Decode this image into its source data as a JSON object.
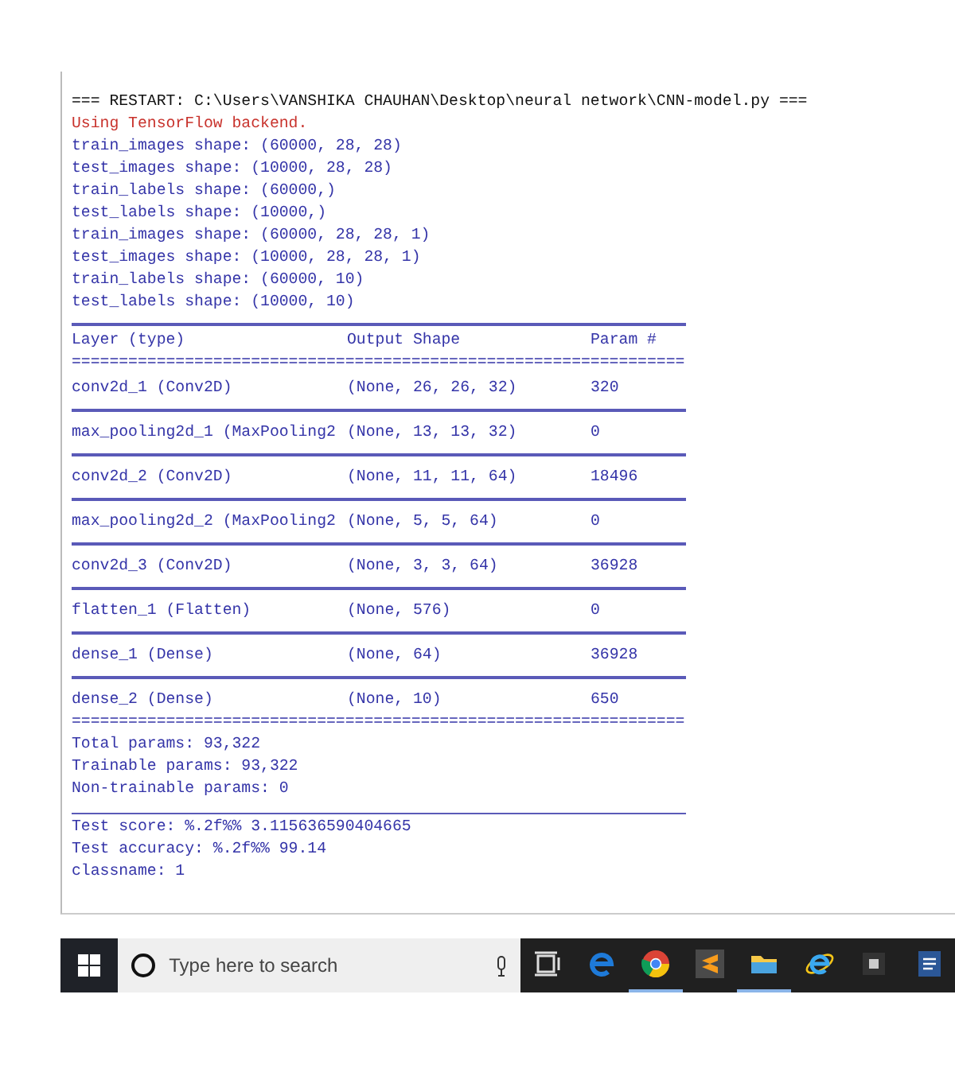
{
  "console": {
    "lines": [
      {
        "kind": "restart",
        "text": "=== RESTART: C:\\Users\\VANSHIKA CHAUHAN\\Desktop\\neural network\\CNN-model.py ==="
      },
      {
        "kind": "stderr",
        "text": "Using TensorFlow backend."
      },
      {
        "kind": "stdout",
        "text": "train_images shape: (60000, 28, 28)"
      },
      {
        "kind": "stdout",
        "text": "test_images shape: (10000, 28, 28)"
      },
      {
        "kind": "stdout",
        "text": "train_labels shape: (60000,)"
      },
      {
        "kind": "stdout",
        "text": "test_labels shape: (10000,)"
      },
      {
        "kind": "stdout",
        "text": "train_images shape: (60000, 28, 28, 1)"
      },
      {
        "kind": "stdout",
        "text": "test_images shape: (10000, 28, 28, 1)"
      },
      {
        "kind": "stdout",
        "text": "train_labels shape: (60000, 10)"
      },
      {
        "kind": "stdout",
        "text": "test_labels shape: (10000, 10)"
      }
    ],
    "summary": {
      "columns": [
        "Layer (type)",
        "Output Shape",
        "Param #"
      ],
      "double_rule": "=================================================================",
      "rows": [
        {
          "cells": [
            "conv2d_1 (Conv2D)",
            "(None, 26, 26, 32)",
            "320"
          ]
        },
        {
          "cells": [
            "max_pooling2d_1 (MaxPooling2",
            "(None, 13, 13, 32)",
            "0"
          ]
        },
        {
          "cells": [
            "conv2d_2 (Conv2D)",
            "(None, 11, 11, 64)",
            "18496"
          ]
        },
        {
          "cells": [
            "max_pooling2d_2 (MaxPooling2",
            "(None, 5, 5, 64)",
            "0"
          ]
        },
        {
          "cells": [
            "conv2d_3 (Conv2D)",
            "(None, 3, 3, 64)",
            "36928"
          ]
        },
        {
          "cells": [
            "flatten_1 (Flatten)",
            "(None, 576)",
            "0"
          ]
        },
        {
          "cells": [
            "dense_1 (Dense)",
            "(None, 64)",
            "36928"
          ]
        },
        {
          "cells": [
            "dense_2 (Dense)",
            "(None, 10)",
            "650"
          ]
        }
      ],
      "closing_rule": "=================================================================",
      "totals": [
        "Total params: 93,322",
        "Trainable params: 93,322",
        "Non-trainable params: 0"
      ]
    },
    "results": [
      "Test score: %.2f%% 3.115636590404665",
      "Test accuracy: %.2f%% 99.14",
      "classname: 1"
    ]
  },
  "taskbar": {
    "search": {
      "placeholder": "Type here to search"
    },
    "apps": [
      {
        "kind": "taskview",
        "running": false
      },
      {
        "kind": "edge",
        "running": false
      },
      {
        "kind": "chrome",
        "running": true
      },
      {
        "kind": "sublime",
        "running": false
      },
      {
        "kind": "explorer",
        "running": true
      },
      {
        "kind": "ie",
        "running": false
      },
      {
        "kind": "generic",
        "running": false
      },
      {
        "kind": "word",
        "running": false
      }
    ]
  }
}
